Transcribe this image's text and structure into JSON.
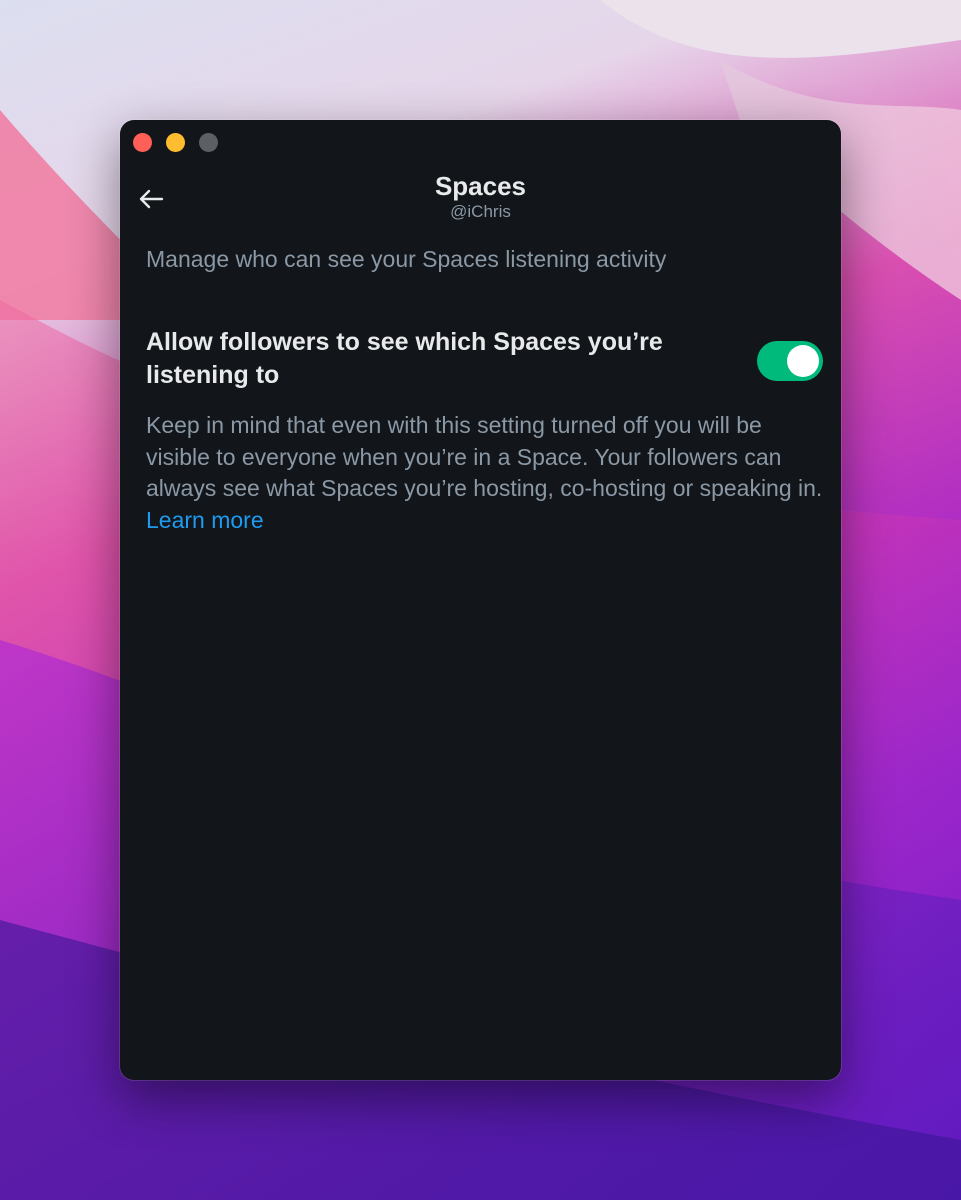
{
  "window": {
    "title": "Spaces",
    "username": "@iChris"
  },
  "page": {
    "subtitle": "Manage who can see your Spaces listening activity"
  },
  "setting": {
    "label": "Allow followers to see which Spaces you’re listening to",
    "enabled": true,
    "description": "Keep in mind that even with this setting turned off you will be visible to everyone when you’re in a Space. Your followers can always see what Spaces you’re hosting, co-hosting or speaking in.",
    "link_text": "Learn more"
  },
  "icons": {
    "back": "arrow-left-icon",
    "close": "close-dot",
    "minimize": "minimize-dot",
    "maximize": "maximize-dot"
  },
  "colors": {
    "window_bg": "#121519",
    "toggle_on": "#00ba7c",
    "link": "#1d9bf0",
    "secondary_text": "#8b98a5",
    "primary_text": "#e7e9ea"
  }
}
